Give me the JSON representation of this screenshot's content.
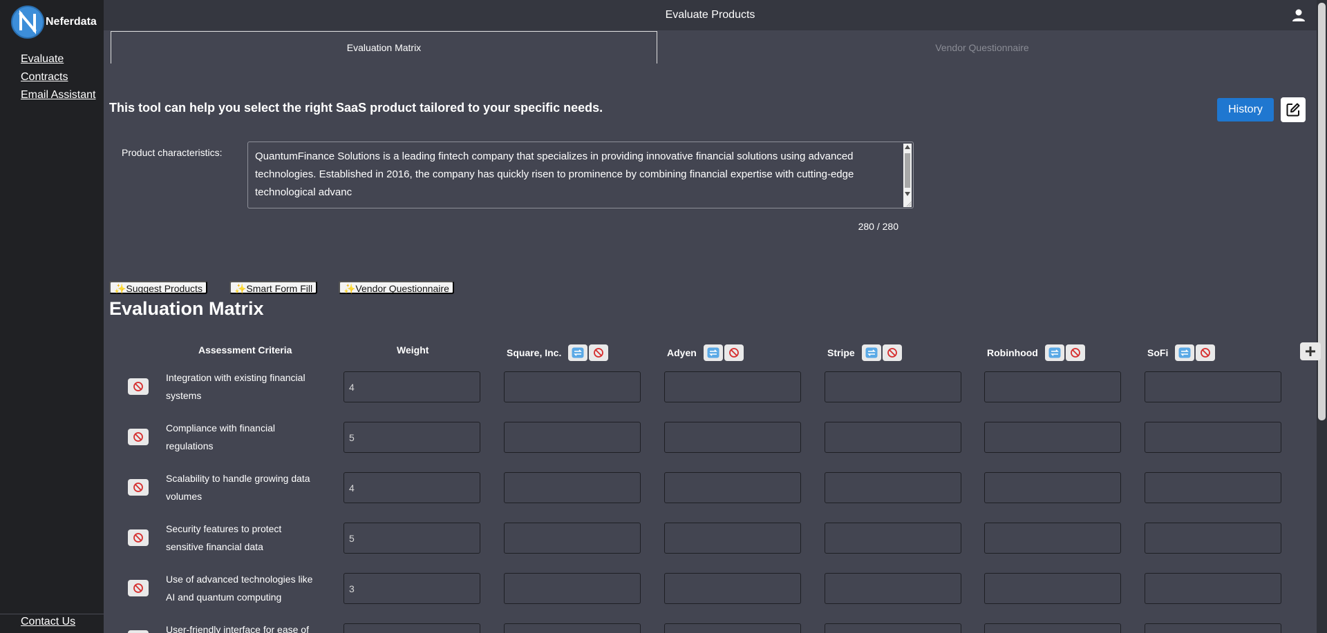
{
  "brand": {
    "name": "Neferdata",
    "logo_letter": "N"
  },
  "sidebar": {
    "items": [
      {
        "label": "Evaluate"
      },
      {
        "label": "Contracts"
      },
      {
        "label": "Email Assistant"
      }
    ],
    "footer_link": "Contact Us"
  },
  "header": {
    "title": "Evaluate Products"
  },
  "tabs": [
    {
      "label": "Evaluation Matrix",
      "active": true
    },
    {
      "label": "Vendor Questionnaire",
      "active": false
    }
  ],
  "intro": {
    "text": "This tool can help you select the right SaaS product tailored to your specific needs."
  },
  "actions": {
    "history_label": "History"
  },
  "product": {
    "label": "Product characteristics:",
    "value": "QuantumFinance Solutions is a leading fintech company that specializes in providing innovative financial solutions using advanced technologies. Established in 2016, the company has quickly risen to prominence by combining financial expertise with cutting-edge technological advanc",
    "char_count": "280 / 280"
  },
  "chips": [
    {
      "label": "✨Suggest Products"
    },
    {
      "label": "✨Smart Form Fill"
    },
    {
      "label": "✨Vendor Questionnaire"
    }
  ],
  "matrix": {
    "title": "Evaluation Matrix",
    "criteria_header": "Assessment Criteria",
    "weight_header": "Weight",
    "vendors": [
      {
        "name": "Square, Inc."
      },
      {
        "name": "Adyen"
      },
      {
        "name": "Stripe"
      },
      {
        "name": "Robinhood"
      },
      {
        "name": "SoFi"
      }
    ],
    "rows": [
      {
        "criterion": "Integration with existing financial systems",
        "weight": "4"
      },
      {
        "criterion": "Compliance with financial regulations",
        "weight": "5"
      },
      {
        "criterion": "Scalability to handle growing data volumes",
        "weight": "4"
      },
      {
        "criterion": "Security features to protect sensitive financial data",
        "weight": "5"
      },
      {
        "criterion": "Use of advanced technologies like AI and quantum computing",
        "weight": "3"
      },
      {
        "criterion": "User-friendly interface for ease of",
        "weight": ""
      }
    ]
  },
  "colors": {
    "background": "#434551",
    "sidebar": "#202124",
    "accent": "#1f77d0"
  }
}
